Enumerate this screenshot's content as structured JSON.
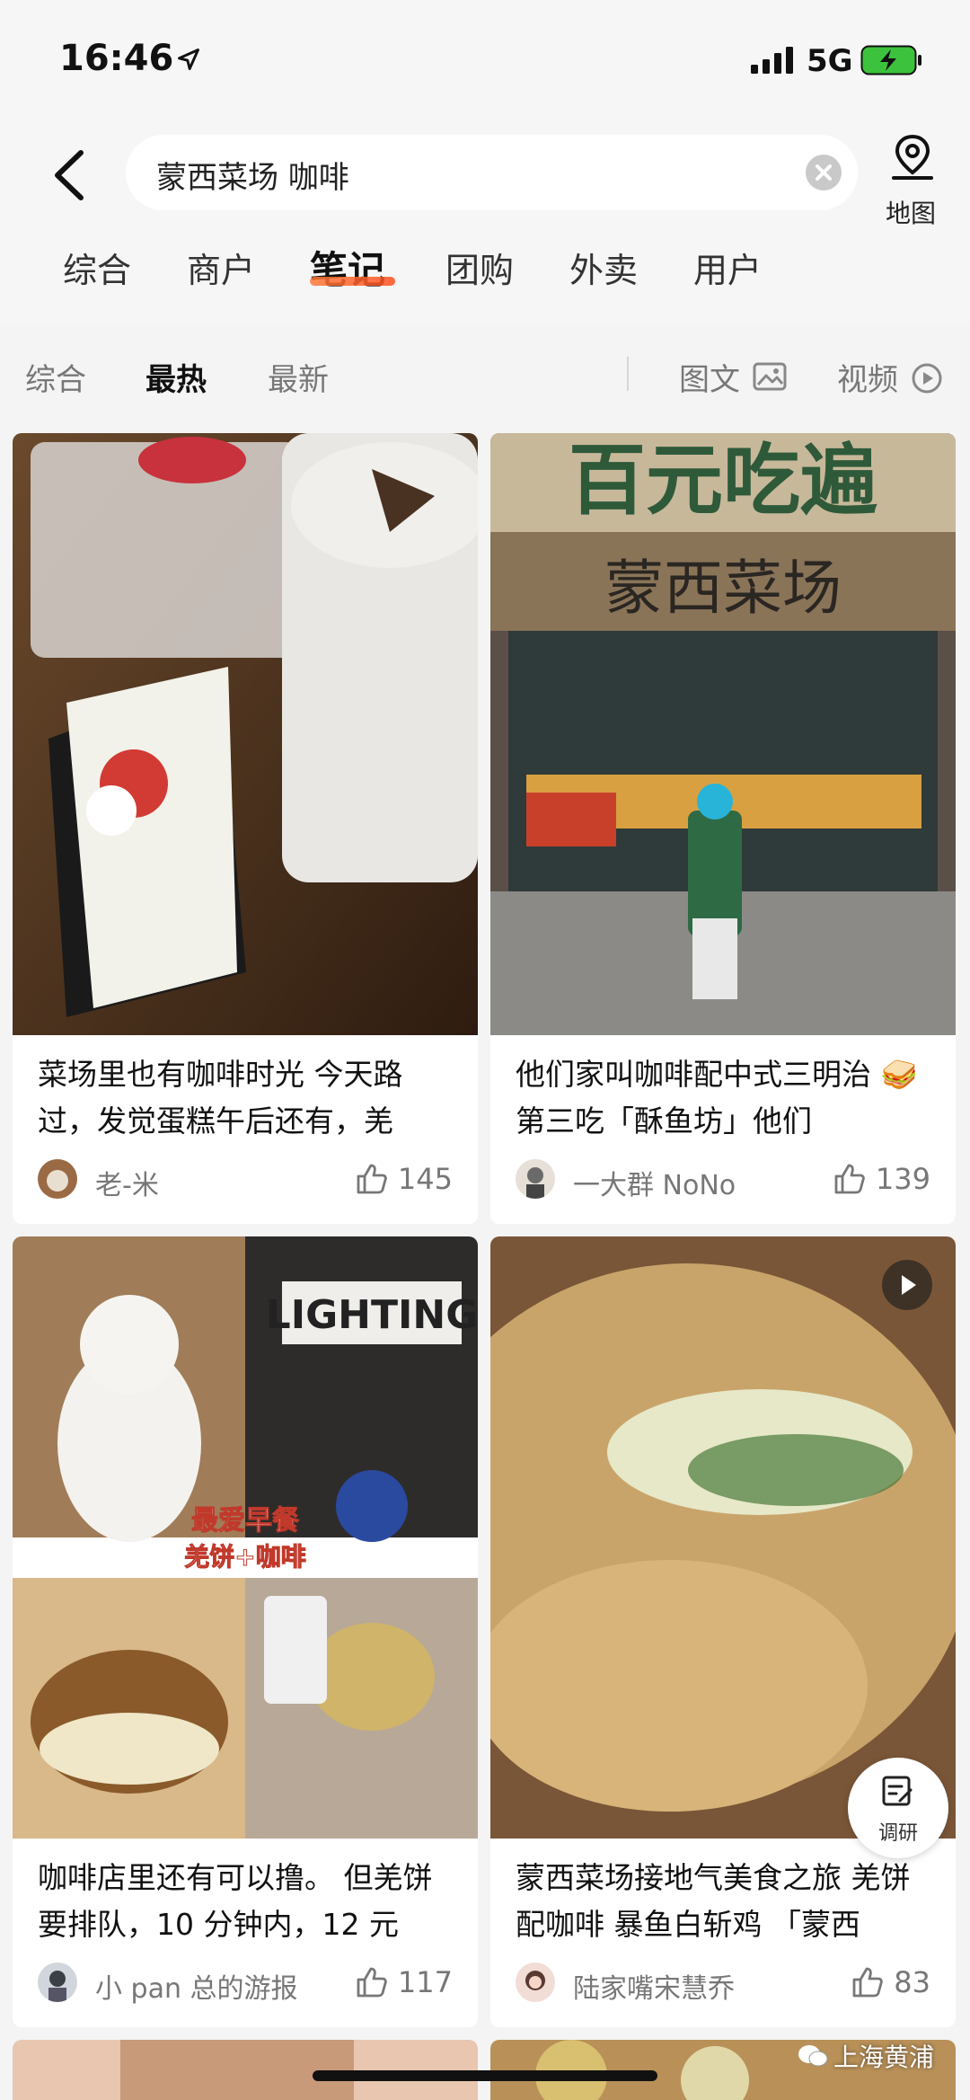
{
  "status": {
    "time": "16:46",
    "network": "5G"
  },
  "search": {
    "query": "蒙西菜场 咖啡"
  },
  "map": {
    "label": "地图"
  },
  "tabs": [
    {
      "label": "综合"
    },
    {
      "label": "商户"
    },
    {
      "label": "笔记"
    },
    {
      "label": "团购"
    },
    {
      "label": "外卖"
    },
    {
      "label": "用户"
    }
  ],
  "active_tab": "笔记",
  "filters": {
    "sort": [
      {
        "label": "综合"
      },
      {
        "label": "最热"
      },
      {
        "label": "最新"
      }
    ],
    "active_sort": "最热",
    "type": [
      {
        "label": "图文"
      },
      {
        "label": "视频"
      }
    ]
  },
  "cards": [
    {
      "title": "菜场里也有咖啡时光 今天路过，发觉蛋糕午后还有，羌",
      "author": "老-米",
      "likes": "145"
    },
    {
      "title": "他们家叫咖啡配中式三明治 🥪 第三吃「酥鱼坊」他们",
      "author": "一大群 NoNo",
      "likes": "139"
    },
    {
      "title": "咖啡店里还有可以撸。 但羌饼要排队，10 分钟内，12 元",
      "author": "小 pan 总的游报",
      "likes": "117"
    },
    {
      "title": "蒙西菜场接地气美食之旅 羌饼配咖啡 暴鱼白斩鸡 「蒙西",
      "author": "陆家嘴宋慧乔",
      "likes": "83"
    }
  ],
  "image_text": {
    "card2_sign_top": "百元吃遍",
    "card2_sign_bottom": "蒙西菜场",
    "card3_caption1": "最爱早餐",
    "card3_caption2": "羌饼+咖啡",
    "card3_sign": "LIGHTING"
  },
  "research": {
    "label": "调研"
  },
  "watermark": "上海黄浦",
  "colors": {
    "accent": "#ff5a1f",
    "background": "#f4f4f4"
  }
}
